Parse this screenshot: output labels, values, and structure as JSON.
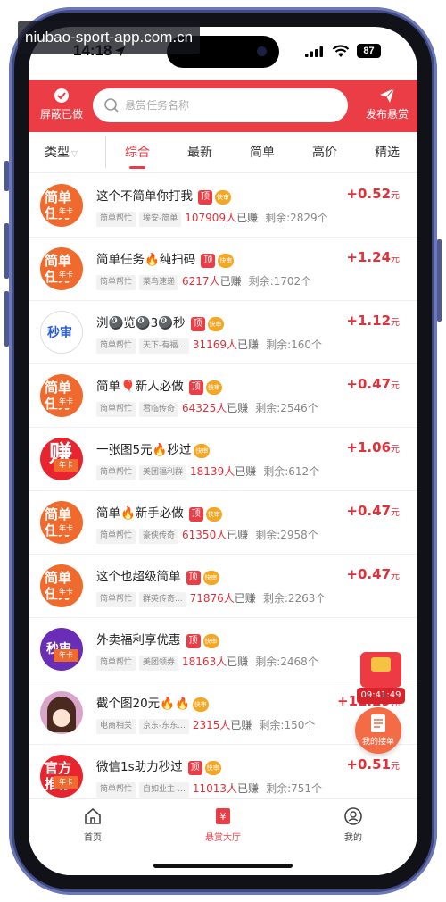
{
  "watermark": "niubao-sport-app.com.cn",
  "status_bar": {
    "time": "14:18",
    "battery": "87"
  },
  "header": {
    "shield_label": "屏蔽已做",
    "search_placeholder": "悬赏任务名称",
    "publish_label": "发布悬赏"
  },
  "tabs": {
    "type_filter": "类型",
    "items": [
      "综合",
      "最新",
      "简单",
      "高价",
      "精选"
    ],
    "active_index": 0
  },
  "badges": {
    "top": "顶",
    "fast": "快审"
  },
  "tasks": [
    {
      "avatar_text": "简单\n任务",
      "avatar_color": "#ef6a2c",
      "card": "年卡",
      "title": "这个不简单你打我",
      "show_top": true,
      "show_fast": true,
      "chips": [
        "简单帮忙",
        "埃安-简单"
      ],
      "earned_count": "107909人",
      "earned_suffix": "已赚",
      "remaining": "剩余:2829个",
      "price": "+0.52",
      "unit": "元"
    },
    {
      "avatar_text": "简单\n任务",
      "avatar_color": "#ef6a2c",
      "card": "年卡",
      "title": "简单任务🔥纯扫码",
      "show_top": true,
      "show_fast": true,
      "chips": [
        "简单帮忙",
        "菜鸟速递"
      ],
      "earned_count": "6217人",
      "earned_suffix": "已赚",
      "remaining": "剩余:1702个",
      "price": "+1.24",
      "unit": "元"
    },
    {
      "avatar_text": "秒审",
      "avatar_color": "#ffffff",
      "card": "",
      "title": "浏🎱览🎱3🎱秒",
      "show_top": true,
      "show_fast": true,
      "chips": [
        "简单帮忙",
        "天下-有福..."
      ],
      "earned_count": "31169人",
      "earned_suffix": "已赚",
      "remaining": "剩余:160个",
      "price": "+1.12",
      "unit": "元"
    },
    {
      "avatar_text": "简单\n任务",
      "avatar_color": "#ef6a2c",
      "card": "年卡",
      "title": "简单🎈新人必做",
      "show_top": true,
      "show_fast": true,
      "chips": [
        "简单帮忙",
        "君临传奇"
      ],
      "earned_count": "64325人",
      "earned_suffix": "已赚",
      "remaining": "剩余:2546个",
      "price": "+0.47",
      "unit": "元"
    },
    {
      "avatar_text": "赚",
      "avatar_color": "#e8252f",
      "card": "年卡",
      "title": "一张图5元🔥秒过",
      "show_top": false,
      "show_fast": true,
      "chips": [
        "简单帮忙",
        "美团福利群"
      ],
      "earned_count": "18139人",
      "earned_suffix": "已赚",
      "remaining": "剩余:612个",
      "price": "+1.06",
      "unit": "元"
    },
    {
      "avatar_text": "简单\n任务",
      "avatar_color": "#ef6a2c",
      "card": "年卡",
      "title": "简单🔥新手必做",
      "show_top": true,
      "show_fast": true,
      "chips": [
        "简单帮忙",
        "豪侠传奇"
      ],
      "earned_count": "61350人",
      "earned_suffix": "已赚",
      "remaining": "剩余:2958个",
      "price": "+0.47",
      "unit": "元"
    },
    {
      "avatar_text": "简单\n任务",
      "avatar_color": "#ef6a2c",
      "card": "年卡",
      "title": "这个也超级简单",
      "show_top": true,
      "show_fast": true,
      "chips": [
        "简单帮忙",
        "群英传奇..."
      ],
      "earned_count": "71876人",
      "earned_suffix": "已赚",
      "remaining": "剩余:2263个",
      "price": "+0.47",
      "unit": "元"
    },
    {
      "avatar_text": "秒审",
      "avatar_color": "#6a2db5",
      "card": "年卡",
      "title": "外卖福利享优惠",
      "show_top": true,
      "show_fast": true,
      "chips": [
        "简单帮忙",
        "美团领券"
      ],
      "earned_count": "18163人",
      "earned_suffix": "已赚",
      "remaining": "剩余:2468个",
      "price": "",
      "unit": ""
    },
    {
      "avatar_text": "",
      "avatar_color": "#d9a6c9",
      "card": "",
      "title": "截个图20元🔥🔥",
      "show_top": false,
      "show_fast": true,
      "chips": [
        "电商相关",
        "京东-东东..."
      ],
      "earned_count": "2315人",
      "earned_suffix": "已赚",
      "remaining": "剩余:150个",
      "price": "+11.29",
      "unit": "元"
    },
    {
      "avatar_text": "官方\n推荐",
      "avatar_color": "#e8252f",
      "card": "年卡",
      "title": "微信1s助力秒过",
      "show_top": true,
      "show_fast": true,
      "chips": [
        "简单帮忙",
        "自如业主-..."
      ],
      "earned_count": "11013人",
      "earned_suffix": "已赚",
      "remaining": "剩余:751个",
      "price": "+0.51",
      "unit": "元"
    }
  ],
  "float_timer": "09:41:49",
  "my_orders_label": "我的接单",
  "bottom_nav": [
    {
      "label": "首页",
      "icon": "home-icon"
    },
    {
      "label": "悬赏大厅",
      "icon": "reward-hall-icon"
    },
    {
      "label": "我的",
      "icon": "profile-icon"
    }
  ],
  "colors": {
    "brand": "#ea3d45",
    "price": "#e0303a"
  }
}
